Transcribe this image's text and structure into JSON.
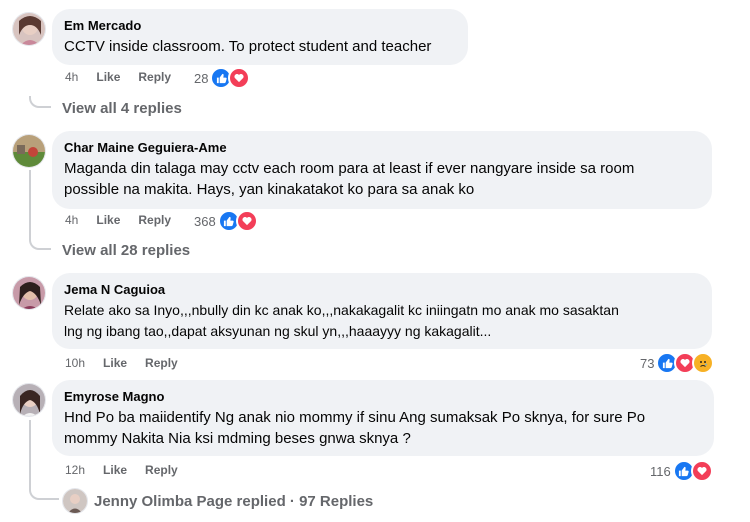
{
  "comments": [
    {
      "author": "Em Mercado",
      "text": "CCTV inside classroom. To protect student and teacher",
      "time": "4h",
      "like_label": "Like",
      "reply_label": "Reply",
      "reaction_count": "28",
      "reactions": [
        "like-icon",
        "love-icon"
      ],
      "view_replies": "View all 4 replies"
    },
    {
      "author": "Char Maine Geguiera-Ame",
      "text_lines": [
        "Maganda din talaga may cctv each room para at least if ever nangyare inside sa room",
        "possible na makita. Hays, yan kinakatakot ko para sa anak ko"
      ],
      "time": "4h",
      "like_label": "Like",
      "reply_label": "Reply",
      "reaction_count": "368",
      "reactions": [
        "like-icon",
        "love-icon"
      ],
      "view_replies": "View all 28 replies"
    },
    {
      "author": "Jema N Caguioa",
      "text_lines": [
        "Relate ako sa Inyo,,,nbully din kc anak ko,,,nakakagalit kc iniingatn mo anak mo sasaktan",
        "lng ng ibang tao,,dapat aksyunan ng skul yn,,,haaayyy ng kakagalit..."
      ],
      "time": "10h",
      "like_label": "Like",
      "reply_label": "Reply",
      "reaction_count": "73",
      "reactions": [
        "like-icon",
        "love-icon",
        "sad-icon"
      ]
    },
    {
      "author": "Emyrose Magno",
      "text_lines": [
        "Hnd Po ba maiidentify Ng anak nio mommy if sinu Ang sumaksak Po sknya, for sure Po",
        "mommy Nakita Nia ksi mdming beses gnwa sknya ?"
      ],
      "time": "12h",
      "like_label": "Like",
      "reply_label": "Reply",
      "reaction_count": "116",
      "reactions": [
        "like-icon",
        "love-icon"
      ],
      "replied_summary": "Jenny Olimba Page replied · 97 Replies"
    }
  ],
  "colors": {
    "bubble": "#f0f2f5",
    "like": "#1877f2",
    "love": "#f33e58",
    "sad": "#f7b125",
    "secondary_text": "#65676b"
  }
}
